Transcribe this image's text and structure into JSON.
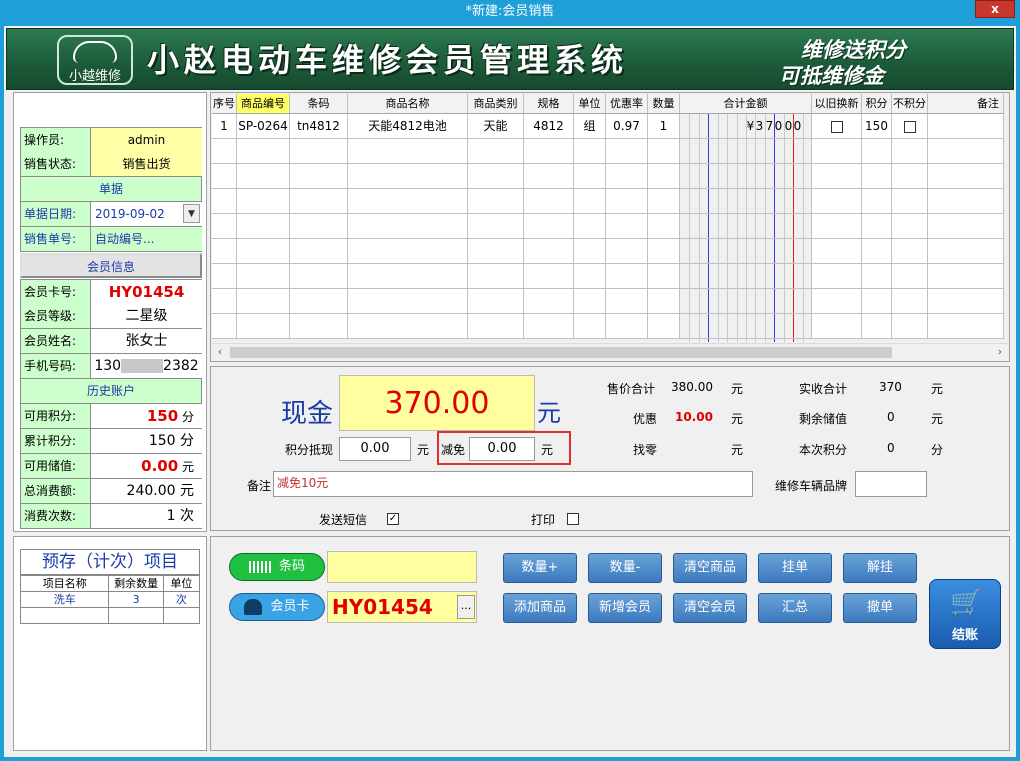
{
  "window": {
    "title": "*新建:会员销售",
    "close": "x"
  },
  "banner": {
    "logo_text": "小越维修",
    "title": "小赵电动车维修会员管理系统",
    "slogan_line1": "维修送积分",
    "slogan_line2": "可抵维修金"
  },
  "left": {
    "operator_label": "操作员:",
    "operator": "admin",
    "status_label": "销售状态:",
    "status": "销售出货",
    "section_doc": "单据",
    "date_label": "单据日期:",
    "date": "2019-09-02",
    "order_no_label": "销售单号:",
    "order_no": "自动编号...",
    "section_member": "会员信息",
    "card_label": "会员卡号:",
    "card": "HY01454",
    "level_label": "会员等级:",
    "level": "二星级",
    "name_label": "会员姓名:",
    "name": "张女士",
    "phone_label": "手机号码:",
    "phone_prefix": "130",
    "phone_suffix": "2382",
    "section_history": "历史账户",
    "avail_points_label": "可用积分:",
    "avail_points": "150",
    "avail_points_unit": "分",
    "total_points_label": "累计积分:",
    "total_points": "150",
    "total_points_unit": "分",
    "avail_balance_label": "可用储值:",
    "avail_balance": "0.00",
    "avail_balance_unit": "元",
    "total_spend_label": "总消费额:",
    "total_spend": "240.00",
    "total_spend_unit": "元",
    "visits_label": "消费次数:",
    "visits": "1",
    "visits_unit": "次"
  },
  "products": {
    "columns": [
      "序号",
      "商品编号",
      "条码",
      "商品名称",
      "商品类别",
      "规格",
      "单位",
      "优惠率",
      "数量",
      "合计金额",
      "以旧换新",
      "积分",
      "不积分",
      "备注"
    ],
    "rows": [
      {
        "no": "1",
        "code": "SP-0264",
        "barcode": "tn4812",
        "name": "天能4812电池",
        "category": "天能",
        "spec": "4812",
        "unit": "组",
        "discount": "0.97",
        "qty": "1",
        "amount_digits": [
          "¥",
          "3",
          "7",
          "0",
          "0",
          "0"
        ],
        "points": "150"
      }
    ]
  },
  "payment": {
    "cash_label": "现金",
    "cash": "370.00",
    "cash_unit": "元",
    "points_offset_label": "积分抵现",
    "points_offset": "0.00",
    "points_offset_unit": "元",
    "reduce_label": "减免",
    "reduce": "0.00",
    "reduce_unit": "元",
    "remark_label": "备注",
    "remark": "减免10元",
    "send_sms_label": "发送短信",
    "print_label": "打印",
    "sale_total_label": "售价合计",
    "sale_total": "380.00",
    "sale_total_unit": "元",
    "discount_label": "优惠",
    "discount": "10.00",
    "discount_unit": "元",
    "change_label": "找零",
    "change_unit": "元",
    "received_label": "实收合计",
    "received": "370",
    "received_unit": "元",
    "balance_label": "剩余储值",
    "balance": "0",
    "balance_unit": "元",
    "points_now_label": "本次积分",
    "points_now": "0",
    "points_now_unit": "分",
    "vehicle_label": "维修车辆品牌"
  },
  "stored": {
    "title": "预存（计次）项目",
    "headers": [
      "项目名称",
      "剩余数量",
      "单位"
    ],
    "rows": [
      [
        "洗车",
        "3",
        "次"
      ]
    ]
  },
  "actions": {
    "barcode_label": "条码",
    "card_label": "会员卡",
    "card_value": "HY01454",
    "card_more": "...",
    "buttons_row1": [
      "数量+",
      "数量-",
      "清空商品",
      "挂单",
      "解挂"
    ],
    "buttons_row2": [
      "添加商品",
      "新增会员",
      "清空会员",
      "汇总",
      "撤单"
    ],
    "checkout": "结账"
  },
  "colors": {
    "title_bar": "#1f9fd8",
    "banner": "#1c5a39",
    "accent_red": "#e00000",
    "label_blue": "#1a3aa8",
    "field_yellow": "#ffffa0",
    "panel_green": "#ccffcc"
  }
}
